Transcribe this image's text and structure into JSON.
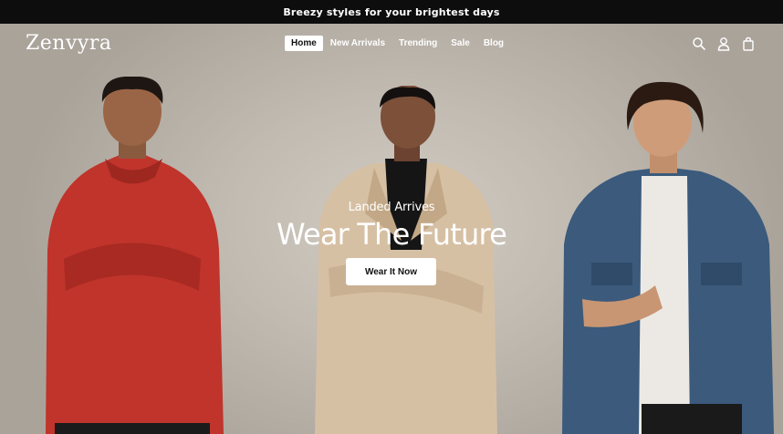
{
  "announcement": {
    "text": "Breezy styles for your brightest days"
  },
  "header": {
    "logo": "Zenvyra",
    "nav": [
      {
        "label": "Home",
        "active": true
      },
      {
        "label": "New Arrivals",
        "active": false
      },
      {
        "label": "Trending",
        "active": false
      },
      {
        "label": "Sale",
        "active": false
      },
      {
        "label": "Blog",
        "active": false
      }
    ],
    "icons": [
      "search-icon",
      "account-icon",
      "cart-icon"
    ]
  },
  "hero": {
    "subtitle": "Landed Arrives",
    "title": "Wear The Future",
    "cta_label": "Wear It Now"
  },
  "colors": {
    "announcement_bg": "#0d0d0d",
    "hero_bg": "#c2bbb2",
    "hoodie_red": "#c0342b",
    "coat_beige": "#d6c0a4",
    "denim_blue": "#3b5a7c"
  }
}
